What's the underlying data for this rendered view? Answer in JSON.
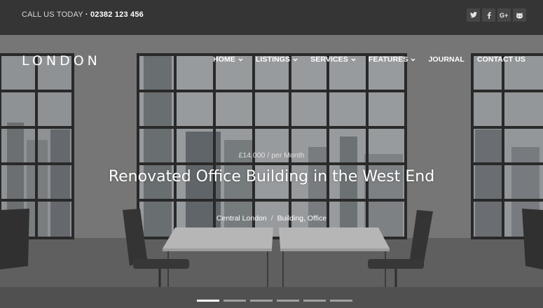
{
  "topbar": {
    "call_label": "CALL US TODAY",
    "phone": "· 02382 123 456",
    "social": [
      {
        "icon": "twitter-icon"
      },
      {
        "icon": "facebook-icon"
      },
      {
        "icon": "google-plus-icon"
      },
      {
        "icon": "github-icon"
      }
    ]
  },
  "brand": {
    "logo": "LONDON"
  },
  "nav": {
    "items": [
      {
        "label": "HOME",
        "dropdown": true
      },
      {
        "label": "LISTINGS",
        "dropdown": true
      },
      {
        "label": "SERVICES",
        "dropdown": true
      },
      {
        "label": "FEATURES",
        "dropdown": true
      },
      {
        "label": "JOURNAL",
        "dropdown": false
      },
      {
        "label": "CONTACT US",
        "dropdown": false
      }
    ]
  },
  "slide": {
    "price": "£14,000 / per Month",
    "title": "Renovated Office Building in the West End",
    "location": "Central London",
    "separator": "/",
    "categories": "Building, Office"
  },
  "slider": {
    "slide_count": 6,
    "active_index": 0
  },
  "colors": {
    "topbar_bg": "#353535",
    "icon_bg": "#464646",
    "text": "#ffffff"
  }
}
